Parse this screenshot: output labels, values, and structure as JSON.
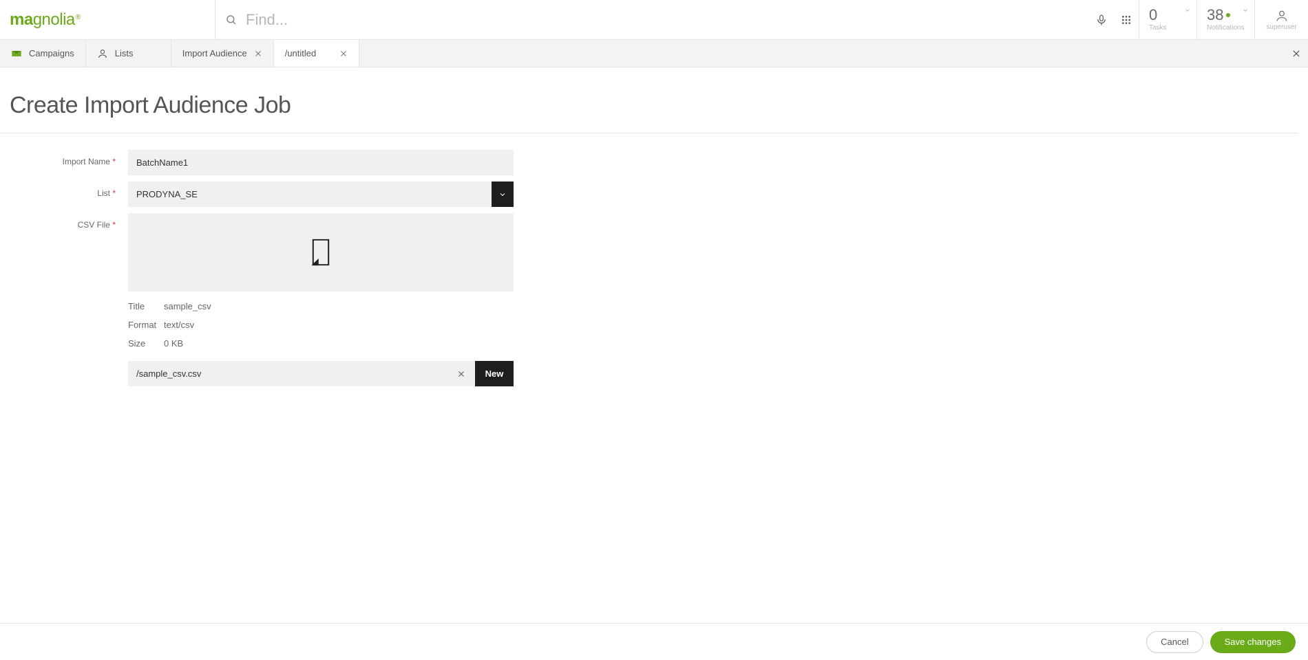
{
  "brand": "magnolia",
  "search": {
    "placeholder": "Find..."
  },
  "topbar": {
    "tasks": {
      "count": "0",
      "label": "Tasks"
    },
    "notifications": {
      "count": "38",
      "label": "Notifications",
      "has_new": true
    },
    "user": {
      "name": "superuser"
    }
  },
  "tabs": [
    {
      "id": "campaigns",
      "label": "Campaigns",
      "icon": "mail-icon",
      "closable": false,
      "active": false
    },
    {
      "id": "lists",
      "label": "Lists",
      "icon": "person-icon",
      "closable": false,
      "active": false
    },
    {
      "id": "import-audience",
      "label": "Import Audience",
      "icon": null,
      "closable": true,
      "active": false
    },
    {
      "id": "untitled",
      "label": "/untitled",
      "icon": null,
      "closable": true,
      "active": true
    }
  ],
  "page": {
    "title": "Create Import Audience Job",
    "fields": {
      "import_name": {
        "label": "Import Name",
        "value": "BatchName1",
        "required": true
      },
      "list": {
        "label": "List",
        "value": "PRODYNA_SE",
        "required": true
      },
      "csv_file": {
        "label": "CSV File",
        "required": true
      }
    },
    "file_meta": {
      "title": {
        "label": "Title",
        "value": "sample_csv"
      },
      "format": {
        "label": "Format",
        "value": "text/csv"
      },
      "size": {
        "label": "Size",
        "value": "0 KB"
      }
    },
    "file_path": {
      "value": "/sample_csv.csv",
      "new_label": "New"
    }
  },
  "footer": {
    "cancel_label": "Cancel",
    "save_label": "Save changes"
  }
}
